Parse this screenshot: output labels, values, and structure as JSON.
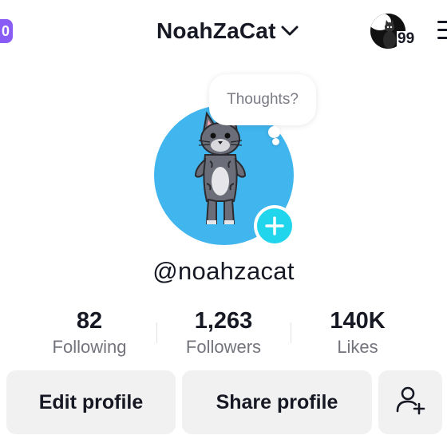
{
  "top_bar": {
    "left_badge": "0",
    "username": "NoahZaCat",
    "friends_count": "99"
  },
  "profile": {
    "thought_placeholder": "Thoughts?",
    "handle": "@noahzacat"
  },
  "stats": [
    {
      "value": "82",
      "label": "Following"
    },
    {
      "value": "1,263",
      "label": "Followers"
    },
    {
      "value": "140K",
      "label": "Likes"
    }
  ],
  "actions": {
    "edit_profile": "Edit profile",
    "share_profile": "Share profile"
  },
  "colors": {
    "avatar_bg": "#40b5ee",
    "add_button": "#20d5ec",
    "badge": "#8a5cf6",
    "button_bg": "#f1f1f2"
  }
}
